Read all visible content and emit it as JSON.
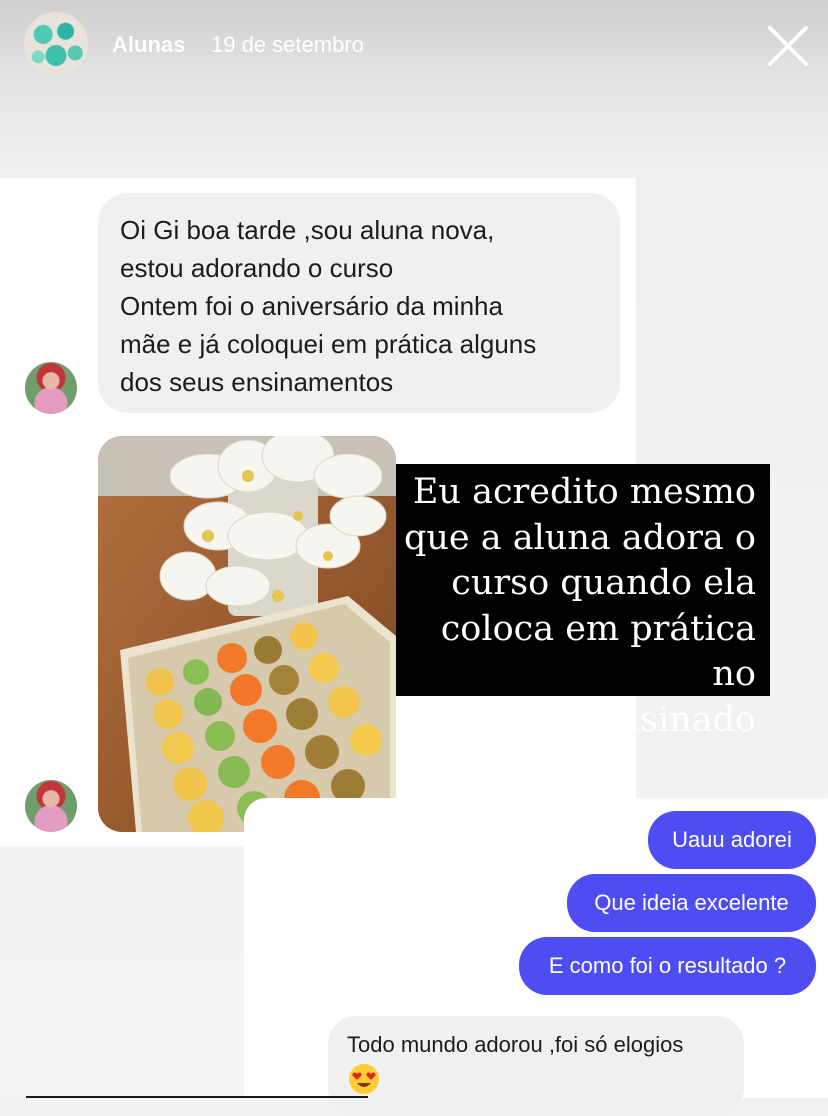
{
  "header": {
    "account_name": "Alunas",
    "date": "19 de setembro"
  },
  "chat": {
    "incoming_message": [
      "Oi Gi boa tarde ,sou aluna nova,",
      "estou adorando o curso",
      "Ontem foi o aniversário da minha",
      "mãe e já coloquei em prática alguns",
      "dos seus ensinamentos"
    ],
    "overlay_text": "Eu acredito mesmo\nque a aluna adora o\ncurso quando ela\ncoloca em prática no\nque é ensinado",
    "outgoing": [
      "Uauu adorei",
      "Que ideia excelente",
      "E como foi o resultado ?"
    ],
    "reply": "Todo mundo adorou ,foi só elogios"
  },
  "colors": {
    "outgoing_bubble": "#4d4df2",
    "incoming_bubble": "#f0f0f0",
    "overlay_bg": "#000000"
  },
  "icons": {
    "close": "close-icon",
    "emoji": "heart-eyes-emoji-icon"
  }
}
